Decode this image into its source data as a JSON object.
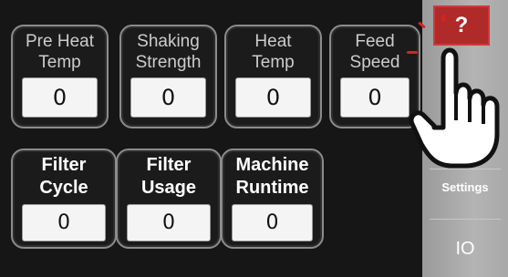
{
  "row1": [
    {
      "label_line1": "Pre Heat",
      "label_line2": "Temp",
      "value": "0"
    },
    {
      "label_line1": "Shaking",
      "label_line2": "Strength",
      "value": "0"
    },
    {
      "label_line1": "Heat",
      "label_line2": "Temp",
      "value": "0"
    },
    {
      "label_line1": "Feed",
      "label_line2": "Speed",
      "value": "0"
    }
  ],
  "row2": [
    {
      "label_line1": "Filter",
      "label_line2": "Cycle",
      "value": "0"
    },
    {
      "label_line1": "Filter",
      "label_line2": "Usage",
      "value": "0"
    },
    {
      "label_line1": "Machine",
      "label_line2": "Runtime",
      "value": "0"
    }
  ],
  "sidebar": {
    "help_label": "?",
    "settings_label": "Settings",
    "io_label": "IO"
  },
  "colors": {
    "help_button": "#b02a2a",
    "tap_marks": "#d32424",
    "sidebar": "#a8a8a8",
    "panel_background": "#161616"
  },
  "icons": {
    "pointer": "hand-pointer-icon"
  }
}
